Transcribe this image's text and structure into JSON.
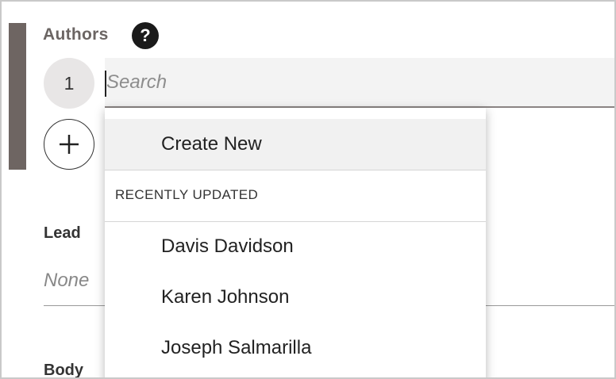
{
  "authors": {
    "label": "Authors",
    "help_icon": "question-mark-icon",
    "index": "1",
    "search_placeholder": "Search",
    "add_icon": "plus-icon"
  },
  "dropdown": {
    "create_new": "Create New",
    "section_header": "RECENTLY UPDATED",
    "recent": [
      "Davis Davidson",
      "Karen Johnson",
      "Joseph Salmarilla"
    ]
  },
  "lead": {
    "label": "Lead",
    "value": "None"
  },
  "body_field": {
    "label": "Body"
  },
  "colors": {
    "side_accent": "#6e6562",
    "help_icon_bg": "#1a1a1a",
    "search_bg": "#f3f3f3",
    "create_new_bg": "#f1f1f1"
  }
}
